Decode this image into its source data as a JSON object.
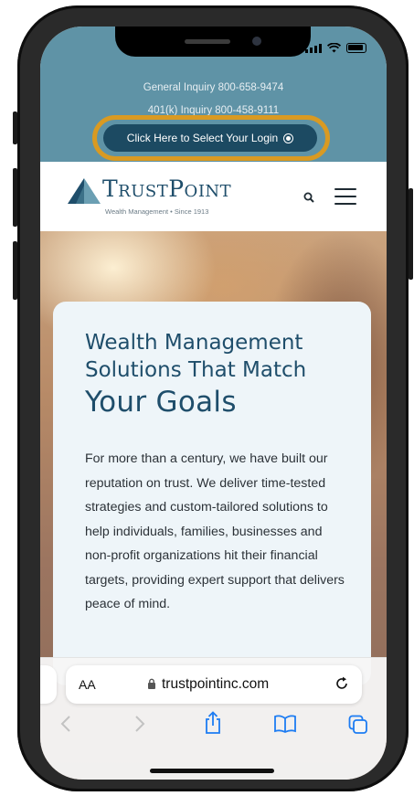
{
  "topbar": {
    "general_inquiry": "General Inquiry 800-658-9474",
    "k401_inquiry": "401(k) Inquiry 800-458-9111",
    "login_button": "Click Here to Select Your Login"
  },
  "logo": {
    "name": "TrustPoint",
    "tagline": "Wealth Management • Since 1913"
  },
  "hero": {
    "heading_line1": "Wealth Management Solutions That Match",
    "heading_line2": "Your Goals",
    "body": "For more than a century, we have built our reputation on trust. We deliver time-tested strategies and custom-tailored solutions to help individuals, families, businesses and non-profit organizations hit their financial targets, providing expert support that delivers peace of mind."
  },
  "safari": {
    "aa_label": "AA",
    "url": "trustpointinc.com"
  },
  "colors": {
    "topbar": "#5f93a6",
    "login_button": "#1c4a62",
    "highlight_ring": "#d99a22",
    "brand_blue": "#1f4e6b",
    "card_bg": "#eef5f9"
  },
  "icons": {
    "status": [
      "signal-icon",
      "wifi-icon",
      "battery-icon"
    ],
    "header": [
      "search-icon",
      "menu-icon"
    ],
    "toolbar": [
      "back-icon",
      "forward-icon",
      "share-icon",
      "bookmarks-icon",
      "tabs-icon"
    ]
  }
}
